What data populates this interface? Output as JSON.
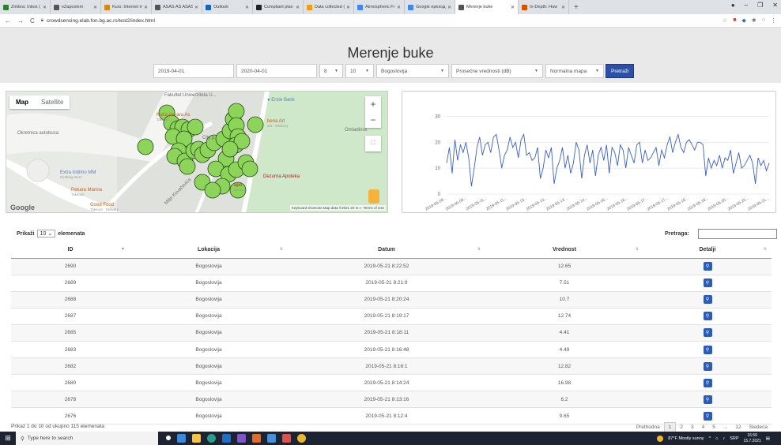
{
  "browser": {
    "tabs": [
      {
        "label": "Zimbra: Inbox (",
        "color": "#2e7d32"
      },
      {
        "label": "eZaposleni",
        "color": "#555555"
      },
      {
        "label": "Kurs: Internet m",
        "color": "#d68910"
      },
      {
        "label": "ASAS AS ASAS",
        "color": "#555555"
      },
      {
        "label": "Outlook",
        "color": "#1565c0"
      },
      {
        "label": "Compliant plan",
        "color": "#222222"
      },
      {
        "label": "Data collected (",
        "color": "#f39c12"
      },
      {
        "label": "Atmospheric Fr",
        "color": "#4285f4"
      },
      {
        "label": "Google npesoд",
        "color": "#4285f4"
      },
      {
        "label": "Merenje buke",
        "color": "#555555",
        "active": true
      },
      {
        "label": "In-Depth: How",
        "color": "#d35400"
      }
    ],
    "url": "crowdsensing.elab.fon.bg.ac.rs/test2/index.html"
  },
  "page": {
    "title": "Merenje buke"
  },
  "filters": {
    "date_from": "2019-04-01",
    "date_to": "2020-04-01",
    "hour_from": "8",
    "hour_to": "10",
    "location": "Bogoslovija",
    "metric": "Prosečne vrednosti (dB)",
    "map_type": "Normalna mapa",
    "search_button": "Pretraži"
  },
  "map": {
    "type_map": "Map",
    "type_satellite": "Satellite",
    "zoom_in": "+",
    "zoom_out": "−",
    "google": "Google",
    "footer": "Keyboard shortcuts   Map data ©2021   20 m ⟝   Terms of Use",
    "labels": {
      "fakultet": "Fakultet Univerziteta U...",
      "erste": "Erste Bank",
      "nasa_pekara": "Naša pekara As",
      "nasa_pekara_sub": "Takeout",
      "okretnica": "Okretnica autobusa",
      "extra": "Extra Inttimo MM",
      "extra_sub": "Clothing store",
      "pekara_marina": "Pekara Marina",
      "pekara_marina_sub": "Takeout",
      "good_food": "Good Food",
      "good_food_sub": "Takeout · Delivery",
      "dezurna": "Dezurna Apoteka",
      "omladinsk": "Omladinsk",
      "milje": "Milje Kovačevića",
      "bena_art": "bena Art",
      "bena_art_sub": "aut · Delivery",
      "city_p": "City p",
      "apo": "apo",
      "sharmacy": "armacy"
    },
    "markers": [
      [
        183,
        185
      ],
      [
        210,
        142
      ],
      [
        216,
        155
      ],
      [
        224,
        162
      ],
      [
        230,
        160
      ],
      [
        238,
        163
      ],
      [
        246,
        160
      ],
      [
        218,
        172
      ],
      [
        232,
        175
      ],
      [
        225,
        190
      ],
      [
        220,
        197
      ],
      [
        233,
        203
      ],
      [
        244,
        190
      ],
      [
        250,
        188
      ],
      [
        255,
        195
      ],
      [
        262,
        189
      ],
      [
        270,
        180
      ],
      [
        282,
        175
      ],
      [
        290,
        165
      ],
      [
        294,
        150
      ],
      [
        298,
        140
      ],
      [
        298,
        158
      ],
      [
        300,
        172
      ],
      [
        297,
        183
      ],
      [
        305,
        178
      ],
      [
        285,
        200
      ],
      [
        272,
        213
      ],
      [
        288,
        220
      ],
      [
        298,
        214
      ],
      [
        310,
        205
      ],
      [
        315,
        213
      ],
      [
        255,
        230
      ],
      [
        280,
        235
      ],
      [
        300,
        240
      ],
      [
        268,
        240
      ],
      [
        236,
        210
      ],
      [
        322,
        157
      ],
      [
        290,
        188
      ]
    ]
  },
  "chart_data": {
    "type": "line",
    "title": "",
    "xlabel": "",
    "ylabel": "",
    "ylim": [
      0,
      35
    ],
    "yticks": [
      0,
      10,
      20,
      30
    ],
    "grid": true,
    "color": "#3a5fcd",
    "x_tick_labels": [
      "2019-05-09...",
      "2019-05-09...",
      "2019-05-11...",
      "2019-05-11...",
      "2019-05-13...",
      "2019-05-13...",
      "2019-05-13...",
      "2019-05-14...",
      "2019-05-16...",
      "2019-05-16...",
      "2019-05-17...",
      "2019-05-17...",
      "2019-05-18...",
      "2019-05-18...",
      "2019-05-20...",
      "2019-05-20...",
      "2019-05-21..."
    ],
    "values": [
      12,
      18,
      8,
      21,
      13,
      19,
      16,
      20,
      14,
      3,
      10,
      18,
      22,
      15,
      19,
      20,
      16,
      22,
      23,
      17,
      10,
      15,
      17,
      22,
      18,
      20,
      14,
      21,
      23,
      15,
      16,
      13,
      14,
      18,
      6,
      10,
      17,
      14,
      18,
      4,
      10,
      13,
      18,
      10,
      15,
      8,
      12,
      20,
      17,
      6,
      15,
      19,
      12,
      17,
      7,
      15,
      18,
      13,
      19,
      8,
      18,
      16,
      11,
      19,
      17,
      10,
      18,
      15,
      12,
      19,
      20,
      12,
      17,
      13,
      14,
      16,
      18,
      11,
      17,
      14,
      19,
      22,
      16,
      20,
      23,
      18,
      16,
      20,
      21,
      19,
      17,
      20,
      20,
      19,
      7,
      14,
      10,
      13,
      11,
      15,
      10,
      14,
      13,
      17,
      8,
      12,
      16,
      10,
      11,
      13,
      15,
      12,
      4,
      14,
      11,
      13,
      9,
      12
    ]
  },
  "table": {
    "length_label_pre": "Prikaži",
    "length_value": "10",
    "length_label_post": "elemenata",
    "search_label": "Pretraga:",
    "columns": [
      "ID",
      "Lokacija",
      "Datum",
      "Vrednost",
      "Detalji"
    ],
    "rows": [
      {
        "id": "2690",
        "loc": "Bogoslovija",
        "date": "2019-05-21 8:22:52",
        "val": "12.65"
      },
      {
        "id": "2689",
        "loc": "Bogoslovija",
        "date": "2019-05-21 8:21:9",
        "val": "7.51"
      },
      {
        "id": "2688",
        "loc": "Bogoslovija",
        "date": "2019-05-21 8:20:24",
        "val": "10.7"
      },
      {
        "id": "2687",
        "loc": "Bogoslovija",
        "date": "2019-05-21 8:19:17",
        "val": "12.74"
      },
      {
        "id": "2685",
        "loc": "Bogoslovija",
        "date": "2019-05-21 8:18:11",
        "val": "4.41"
      },
      {
        "id": "2683",
        "loc": "Bogoslovija",
        "date": "2019-05-21 8:16:48",
        "val": "4.49"
      },
      {
        "id": "2682",
        "loc": "Bogoslovija",
        "date": "2019-05-21 8:16:1",
        "val": "12.82"
      },
      {
        "id": "2680",
        "loc": "Bogoslovija",
        "date": "2019-05-21 8:14:24",
        "val": "16.98"
      },
      {
        "id": "2678",
        "loc": "Bogoslovija",
        "date": "2019-05-21 8:13:16",
        "val": "6.2"
      },
      {
        "id": "2676",
        "loc": "Bogoslovija",
        "date": "2019-05-21 8:12:4",
        "val": "9.65"
      }
    ],
    "info": "Prikaz 1 do 10 od ukupno 115 elemenata",
    "pager": {
      "prev": "Prethodna",
      "pages": [
        "1",
        "2",
        "3",
        "4",
        "5",
        "...",
        "12"
      ],
      "next": "Sledeća"
    }
  },
  "taskbar": {
    "search_placeholder": "Type here to search",
    "weather": "87°F  Mostly sunny",
    "lang": "SRP",
    "time": "16:59",
    "date": "15.7.2021"
  }
}
